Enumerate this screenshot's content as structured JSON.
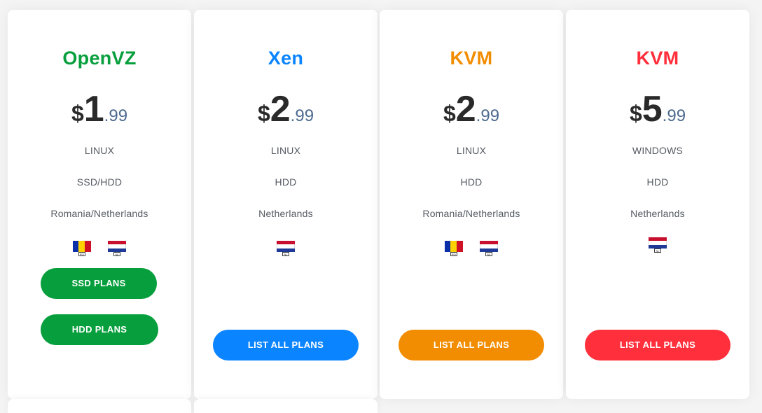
{
  "plans": [
    {
      "name": "OpenVZ",
      "color": "#079f3d",
      "currency": "$",
      "price_int": "1",
      "price_dec": ".99",
      "os": "LINUX",
      "storage": "SSD/HDD",
      "location": "Romania/Netherlands",
      "flags": [
        {
          "name": "romania-flag",
          "code": "RO"
        },
        {
          "name": "netherlands-flag",
          "code": "NL"
        }
      ],
      "buttons": [
        {
          "label": "SSD PLANS"
        },
        {
          "label": "HDD PLANS"
        }
      ]
    },
    {
      "name": "Xen",
      "color": "#0a84ff",
      "currency": "$",
      "price_int": "2",
      "price_dec": ".99",
      "os": "LINUX",
      "storage": "HDD",
      "location": "Netherlands",
      "flags": [
        {
          "name": "netherlands-flag",
          "code": "NL"
        }
      ],
      "buttons": [
        {
          "label": "LIST ALL PLANS"
        }
      ]
    },
    {
      "name": "KVM",
      "color": "#f28c00",
      "currency": "$",
      "price_int": "2",
      "price_dec": ".99",
      "os": "LINUX",
      "storage": "HDD",
      "location": "Romania/Netherlands",
      "flags": [
        {
          "name": "romania-flag",
          "code": "RO"
        },
        {
          "name": "netherlands-flag",
          "code": "NL"
        }
      ],
      "buttons": [
        {
          "label": "LIST ALL PLANS"
        }
      ]
    },
    {
      "name": "KVM",
      "color": "#ff2f3b",
      "currency": "$",
      "price_int": "5",
      "price_dec": ".99",
      "os": "WINDOWS",
      "storage": "HDD",
      "location": "Netherlands",
      "flags": [
        {
          "name": "netherlands-flag",
          "code": "NL"
        }
      ],
      "buttons": [
        {
          "label": "LIST ALL PLANS"
        }
      ]
    }
  ]
}
